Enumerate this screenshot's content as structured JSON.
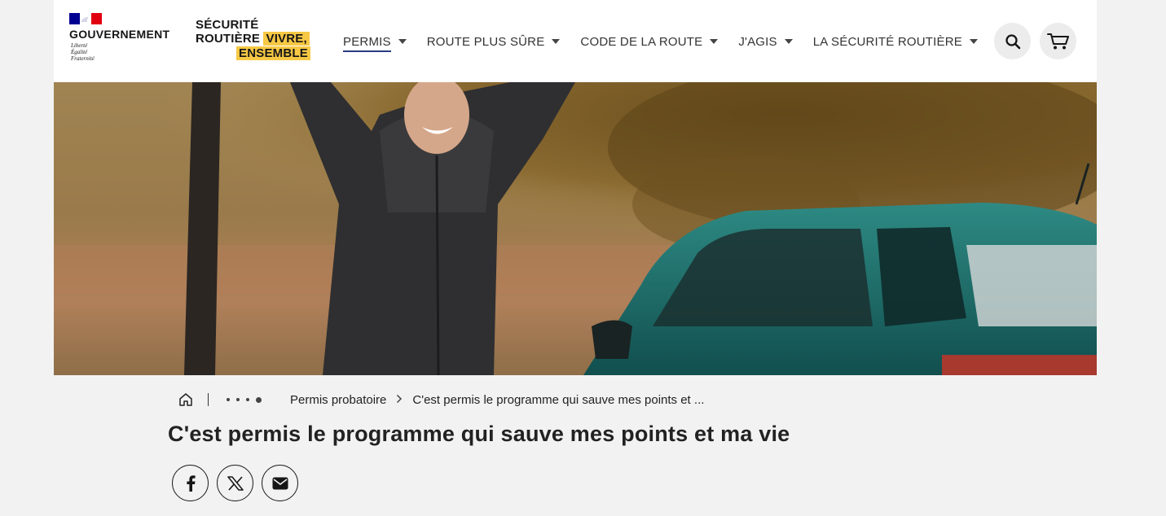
{
  "header": {
    "gov_logo": {
      "name": "GOUVERNEMENT",
      "motto": [
        "Liberté",
        "Égalité",
        "Fraternité"
      ],
      "flag_colors": [
        "#000091",
        "#ffffff",
        "#e1000f"
      ]
    },
    "brand_logo": {
      "line1": "SÉCURITÉ",
      "line2_a": "ROUTIÈRE",
      "line2_b": "VIVRE,",
      "line3": "ENSEMBLE",
      "highlight_color": "#f7c844"
    },
    "nav": [
      {
        "label": "PERMIS",
        "active": true
      },
      {
        "label": "ROUTE PLUS SÛRE",
        "active": false
      },
      {
        "label": "CODE DE LA ROUTE",
        "active": false
      },
      {
        "label": "J'AGIS",
        "active": false
      },
      {
        "label": "LA SÉCURITÉ ROUTIÈRE",
        "active": false
      }
    ],
    "icons": {
      "search": "search-icon",
      "cart": "cart-icon"
    }
  },
  "breadcrumb": {
    "home_icon": "home-icon",
    "items": [
      "Permis probatoire",
      "C'est permis le programme qui sauve mes points et ..."
    ]
  },
  "page": {
    "title": "C'est permis le programme qui sauve mes points et ma vie"
  },
  "share": [
    {
      "icon": "facebook-icon"
    },
    {
      "icon": "x-icon"
    },
    {
      "icon": "email-icon"
    }
  ],
  "colors": {
    "accent": "#2a3b82",
    "page_bg": "#f2f2f2",
    "car": "#1d6d6a"
  }
}
